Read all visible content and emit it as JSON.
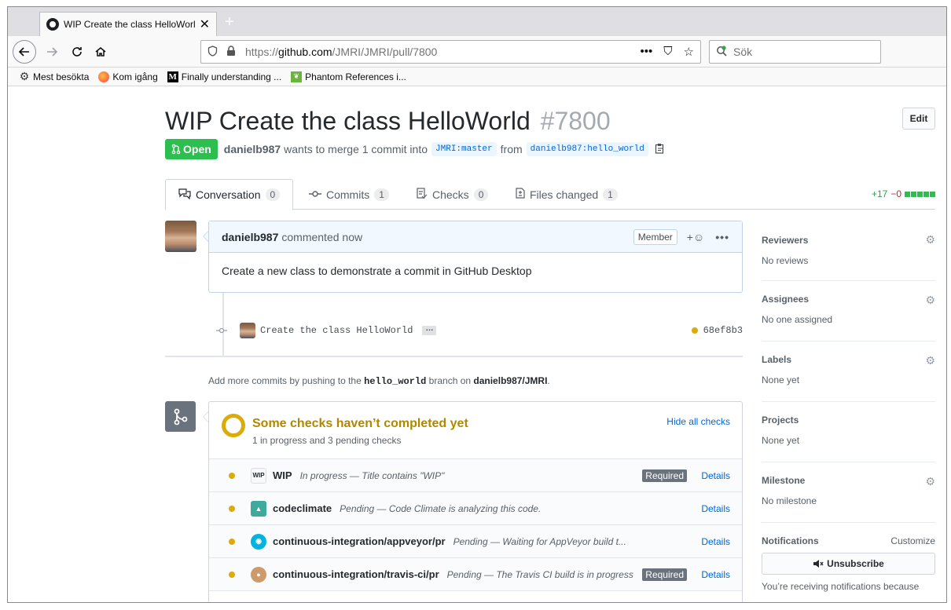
{
  "browser": {
    "tab_title": "WIP Create the class HelloWorld",
    "tab_close": "✕",
    "new_tab": "+",
    "url": {
      "prefix": "https://",
      "domain": "github.com",
      "path": "/JMRI/JMRI/pull/7800"
    },
    "search_placeholder": "Sök",
    "url_actions": [
      "•••",
      "⛉",
      "☆"
    ],
    "bookmarks": [
      {
        "label": "Mest besökta",
        "icon": "gear-icon"
      },
      {
        "label": "Kom igång",
        "icon": "firefox-icon"
      },
      {
        "label": "Finally understanding ...",
        "icon": "medium-icon"
      },
      {
        "label": "Phantom References i...",
        "icon": "leaf-icon"
      }
    ]
  },
  "pr": {
    "title": "WIP Create the class HelloWorld",
    "number": "#7800",
    "edit_label": "Edit",
    "state": "Open",
    "author": "danielb987",
    "merge_text_1": "wants to merge 1 commit into",
    "base_branch": "JMRI:master",
    "merge_text_2": "from",
    "head_branch": "danielb987:hello_world"
  },
  "tabs": [
    {
      "label": "Conversation",
      "count": "0"
    },
    {
      "label": "Commits",
      "count": "1"
    },
    {
      "label": "Checks",
      "count": "0"
    },
    {
      "label": "Files changed",
      "count": "1"
    }
  ],
  "diffstat": {
    "additions": "+17",
    "deletions": "−0"
  },
  "comment": {
    "author": "danielb987",
    "action": "commented now",
    "badge": "Member",
    "react": "+☺",
    "more": "•••",
    "body": "Create a new class to demonstrate a commit in GitHub Desktop"
  },
  "commit": {
    "message": "Create the class HelloWorld",
    "ellipsis": "…",
    "sha": "68ef8b3"
  },
  "push_hint": {
    "pre": "Add more commits by pushing to the",
    "branch": "hello_world",
    "mid": "branch on",
    "repo": "danielb987/JMRI",
    "post": "."
  },
  "checks": {
    "title": "Some checks haven’t completed yet",
    "subtitle": "1 in progress and 3 pending checks",
    "hide_label": "Hide all checks",
    "details_label": "Details",
    "required_label": "Required",
    "items": [
      {
        "name": "WIP",
        "logo": "WIP",
        "desc": "In progress — Title contains \"WIP\"",
        "required": true
      },
      {
        "name": "codeclimate",
        "logo": "▲",
        "desc": "Pending — Code Climate is analyzing this code.",
        "required": false
      },
      {
        "name": "continuous-integration/appveyor/pr",
        "logo": "◉",
        "desc": "Pending — Waiting for AppVeyor build t...",
        "required": false
      },
      {
        "name": "continuous-integration/travis-ci/pr",
        "logo": "●",
        "desc": "Pending — The Travis CI build is in progress",
        "required": true
      }
    ]
  },
  "sidebar": {
    "reviewers": {
      "label": "Reviewers",
      "value": "No reviews"
    },
    "assignees": {
      "label": "Assignees",
      "value": "No one assigned"
    },
    "labels": {
      "label": "Labels",
      "value": "None yet"
    },
    "projects": {
      "label": "Projects",
      "value": "None yet"
    },
    "milestone": {
      "label": "Milestone",
      "value": "No milestone"
    },
    "notifications": {
      "label": "Notifications",
      "customize": "Customize",
      "unsubscribe": "Unsubscribe",
      "note": "You’re receiving notifications because"
    }
  },
  "colors": {
    "open_green": "#2cbe4e",
    "link_blue": "#0366d6",
    "pending_yellow": "#dbab09"
  }
}
